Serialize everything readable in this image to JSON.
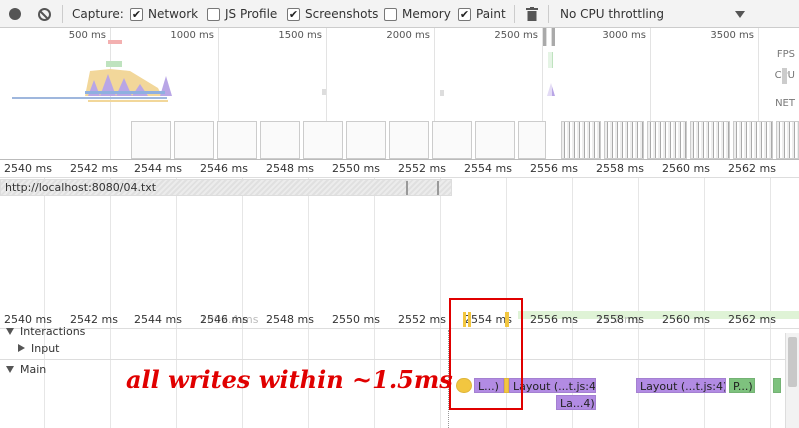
{
  "toolbar": {
    "capture_label": "Capture:",
    "network": {
      "label": "Network",
      "checked": true
    },
    "js_profile": {
      "label": "JS Profile",
      "checked": false
    },
    "screenshots": {
      "label": "Screenshots",
      "checked": true
    },
    "memory": {
      "label": "Memory",
      "checked": false
    },
    "paint": {
      "label": "Paint",
      "checked": true
    },
    "cpu_throttle": "No CPU throttling"
  },
  "overview": {
    "ticks": [
      "500 ms",
      "1000 ms",
      "1500 ms",
      "2000 ms",
      "2500 ms",
      "3000 ms",
      "3500 ms"
    ],
    "side_labels": {
      "fps": "FPS",
      "cpu": "CPU",
      "net": "NET"
    }
  },
  "ruler": {
    "ticks": [
      "2540 ms",
      "2542 ms",
      "2544 ms",
      "2546 ms",
      "2548 ms",
      "2550 ms",
      "2552 ms",
      "2554 ms",
      "2556 ms",
      "2558 ms",
      "2560 ms",
      "2562 ms"
    ],
    "faint_labels": [
      "1002.4 ms",
      "17.7 ms"
    ]
  },
  "network": {
    "request_url": "http://localhost:8080/04.txt"
  },
  "tracks": {
    "interactions": "Interactions",
    "input": "Input",
    "main": "Main"
  },
  "events": {
    "ev1": "L...)",
    "ev2": "Layout (...t.js:4)",
    "ev3": "La...4)",
    "ev4": "Layout (...t.js:4)",
    "ev5": "P...)"
  },
  "annotation": "all writes within ~1.5ms",
  "colors": {
    "annotation": "#e00000",
    "layout": "#b28be3",
    "paint": "#7ec27e",
    "scripting": "#f2c640"
  }
}
